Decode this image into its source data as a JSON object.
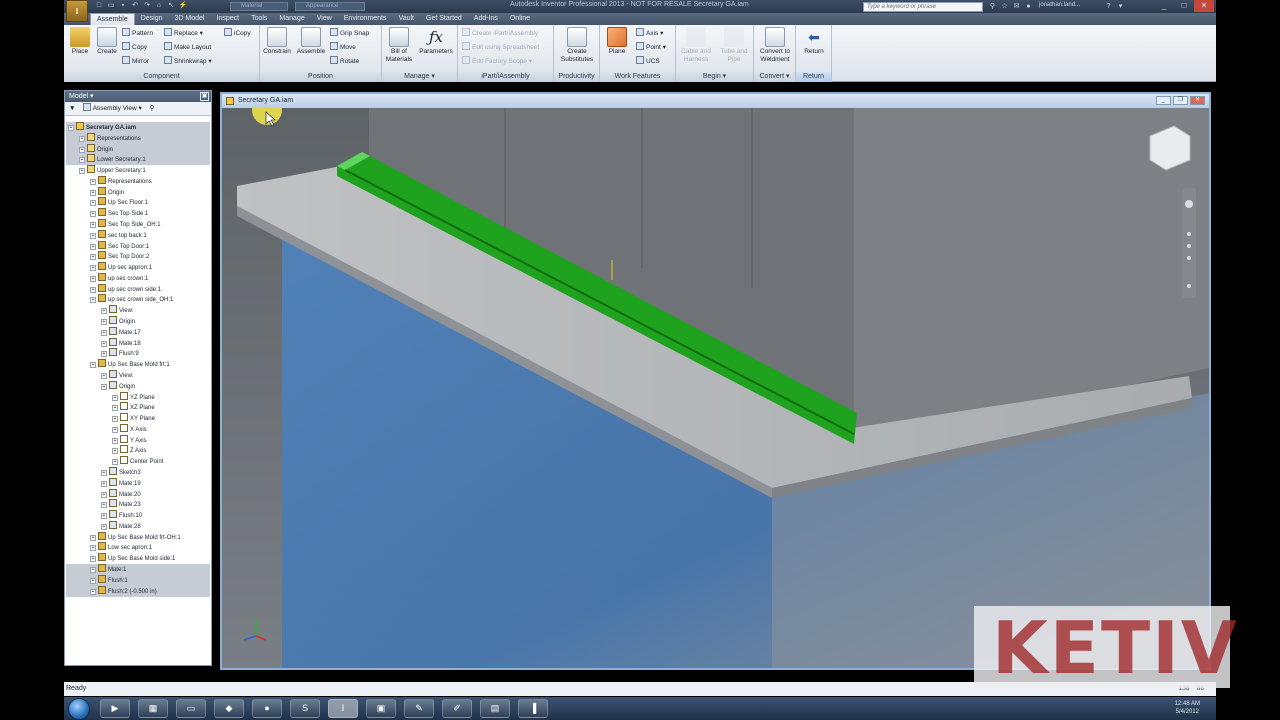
{
  "titlebar": {
    "app_button": "I",
    "material_dropdown": "Material",
    "appearance_dropdown": "Appearance",
    "window_title": "Autodesk Inventor Professional 2013 - NOT FOR RESALE  Secretary GA.iam",
    "search_placeholder": "Type a keyword or phrase",
    "user": "jonathan.land..."
  },
  "tabs": [
    "Assemble",
    "Design",
    "3D Model",
    "Inspect",
    "Tools",
    "Manage",
    "View",
    "Environments",
    "Vault",
    "Get Started",
    "Add-Ins",
    "Online"
  ],
  "ribbon": {
    "component": {
      "label": "Component",
      "place": "Place",
      "create": "Create",
      "pattern": "Pattern",
      "copy": "Copy",
      "mirror": "Mirror",
      "replace": "Replace",
      "make_layout": "Make Layout",
      "shrinkwrap": "Shrinkwrap",
      "icopy": "iCopy"
    },
    "position": {
      "label": "Position",
      "constrain": "Constrain",
      "assemble": "Assemble",
      "grip_snap": "Grip Snap",
      "move": "Move",
      "rotate": "Rotate"
    },
    "manage": {
      "label": "Manage",
      "bom_1": "Bill of",
      "bom_2": "Materials",
      "parameters": "Parameters"
    },
    "ipart": {
      "label": "iPart/iAssembly",
      "create": "Create iPart/iAssembly",
      "edit": "Edit using Spreadsheet",
      "factory": "Edit Factory Scope"
    },
    "productivity": {
      "label": "Productivity",
      "create_1": "Create",
      "create_2": "Substitutes"
    },
    "work": {
      "label": "Work Features",
      "plane": "Plane",
      "axis": "Axis",
      "point": "Point",
      "ucs": "UCS"
    },
    "begin": {
      "label": "Begin",
      "cable_1": "Cable and",
      "cable_2": "Harness",
      "tube_1": "Tube and",
      "tube_2": "Pipe"
    },
    "convert": {
      "label": "Convert",
      "weld_1": "Convert to",
      "weld_2": "Weldment"
    },
    "return_panel": {
      "label": "Return",
      "return": "Return"
    }
  },
  "browser": {
    "header": "Model",
    "view": "Assembly View",
    "tree": [
      {
        "label": "Secretary GA.iam",
        "level": 0,
        "hl": true,
        "bold": true
      },
      {
        "label": "Representations",
        "level": 1,
        "hl": true
      },
      {
        "label": "Origin",
        "level": 1,
        "hl": true
      },
      {
        "label": "Lower Secretary:1",
        "level": 1,
        "hl": true
      },
      {
        "label": "Upper Secretary:1",
        "level": 1
      },
      {
        "label": "Representations",
        "level": 2
      },
      {
        "label": "Origin",
        "level": 2
      },
      {
        "label": "Up Sec Floor:1",
        "level": 2
      },
      {
        "label": "Sec Top Side:1",
        "level": 2
      },
      {
        "label": "Sec Top Side_OH:1",
        "level": 2
      },
      {
        "label": "sec top back:1",
        "level": 2
      },
      {
        "label": "Sec Top Door:1",
        "level": 2
      },
      {
        "label": "Sec Top Door:2",
        "level": 2
      },
      {
        "label": "Up sec appron:1",
        "level": 2
      },
      {
        "label": "up sec crown:1",
        "level": 2
      },
      {
        "label": "up sec crown side:1",
        "level": 2
      },
      {
        "label": "up sec crown side_OH:1",
        "level": 2
      },
      {
        "label": "View:",
        "level": 3
      },
      {
        "label": "Origin",
        "level": 3
      },
      {
        "label": "Mate:17",
        "level": 3
      },
      {
        "label": "Mate:18",
        "level": 3
      },
      {
        "label": "Flush:9",
        "level": 3
      },
      {
        "label": "Up Sec Base Mold frt:1",
        "level": 2
      },
      {
        "label": "View:",
        "level": 3
      },
      {
        "label": "Origin",
        "level": 3
      },
      {
        "label": "YZ Plane",
        "level": 4
      },
      {
        "label": "XZ Plane",
        "level": 4
      },
      {
        "label": "XY Plane",
        "level": 4
      },
      {
        "label": "X Axis",
        "level": 4
      },
      {
        "label": "Y Axis",
        "level": 4
      },
      {
        "label": "Z Axis",
        "level": 4
      },
      {
        "label": "Center Point",
        "level": 4
      },
      {
        "label": "Sketch3",
        "level": 3
      },
      {
        "label": "Mate:19",
        "level": 3
      },
      {
        "label": "Mate:20",
        "level": 3
      },
      {
        "label": "Mate:23",
        "level": 3
      },
      {
        "label": "Flush:10",
        "level": 3
      },
      {
        "label": "Mate:28",
        "level": 3
      },
      {
        "label": "Up Sec Base Mold frt-OH:1",
        "level": 2
      },
      {
        "label": "Low sec apron:1",
        "level": 2
      },
      {
        "label": "Up Sec Base Mold side:1",
        "level": 2
      },
      {
        "label": "Mate:1",
        "level": 2,
        "hl": true
      },
      {
        "label": "Flush:1",
        "level": 2,
        "hl": true
      },
      {
        "label": "Flush:2 (-0.500 in)",
        "level": 2,
        "hl": true
      }
    ]
  },
  "graphics": {
    "doc_title": "Secretary GA.iam"
  },
  "status": {
    "text": "Ready",
    "count_1": "136",
    "count_2": "86"
  },
  "taskbar": {
    "time": "12:48 AM",
    "date": "5/4/2012"
  },
  "watermark": "KETIV",
  "colors": {
    "accent_green": "#1fa31f",
    "glass_blue": "#3f7fc0",
    "ribbon_bg": "#e8ecf1"
  }
}
